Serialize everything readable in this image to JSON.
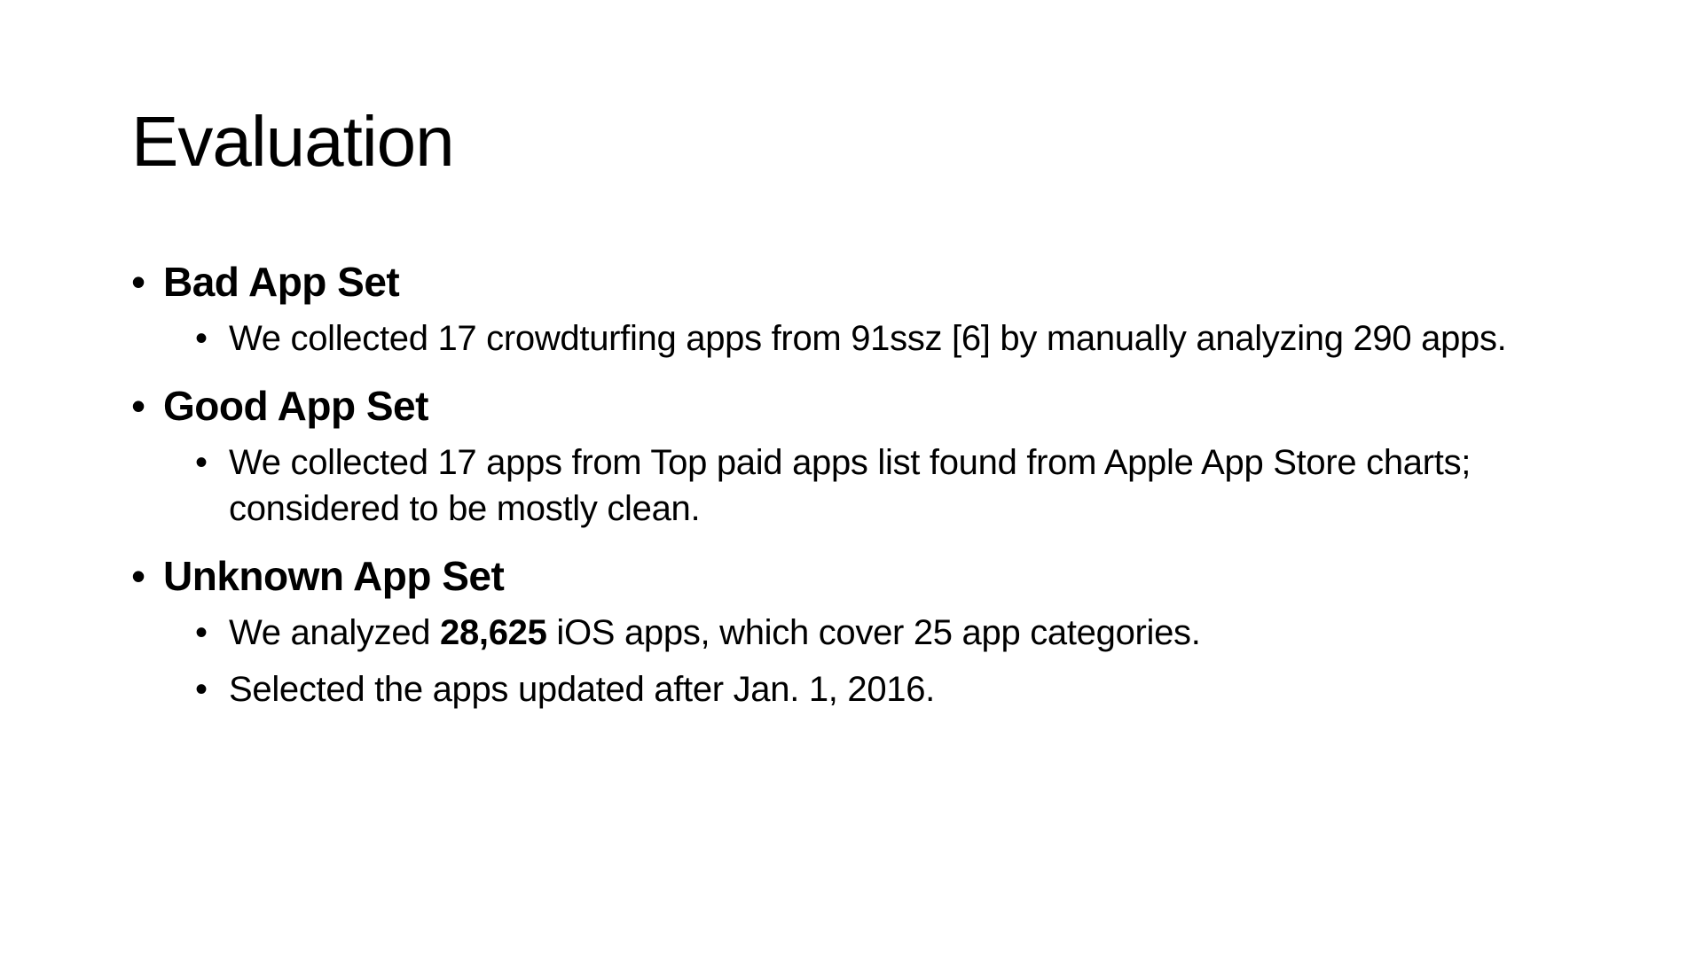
{
  "slide": {
    "title": "Evaluation",
    "sections": [
      {
        "heading": "Bad App Set",
        "bullets": [
          "We collected 17 crowdturfing apps from 91ssz [6] by manually analyzing 290 apps."
        ]
      },
      {
        "heading": "Good App Set",
        "bullets": [
          "We collected 17 apps from Top paid apps list found from Apple App Store charts; considered to be mostly clean."
        ]
      },
      {
        "heading": "Unknown App Set",
        "bullets": [
          {
            "before": "We analyzed ",
            "bold": "28,625",
            "after": " iOS apps, which cover 25 app categories."
          },
          "Selected the apps updated after Jan. 1, 2016."
        ]
      }
    ],
    "bullet_glyph": "•"
  }
}
